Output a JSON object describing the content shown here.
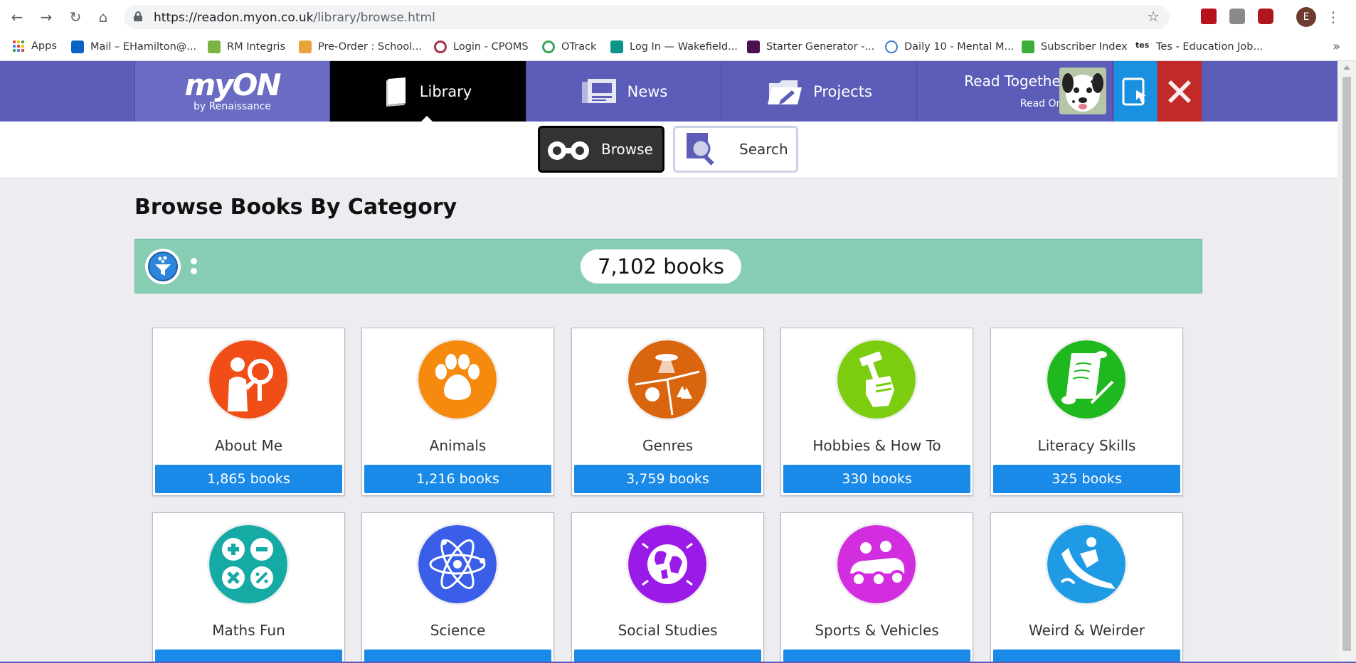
{
  "browser": {
    "url_host": "https://readon.myon.co.uk",
    "url_path": "/library/browse.html",
    "profile_initial": "E",
    "bookmarks": [
      {
        "label": "Apps",
        "color": "#4285f4"
      },
      {
        "label": "Mail – EHamilton@...",
        "color": "#0a64c4"
      },
      {
        "label": "RM Integris",
        "color": "#7cb342"
      },
      {
        "label": "Pre-Order : School...",
        "color": "#e8a23a"
      },
      {
        "label": "Login - CPOMS",
        "color": "#a8344a"
      },
      {
        "label": "OTrack",
        "color": "#3ba55d"
      },
      {
        "label": "Log In — Wakefield...",
        "color": "#0d9488"
      },
      {
        "label": "Starter Generator -...",
        "color": "#4a1050"
      },
      {
        "label": "Daily 10 - Mental M...",
        "color": "#3d7cc9"
      },
      {
        "label": "Subscriber Index",
        "color": "#3cae3a"
      },
      {
        "label": "Tes - Education Job...",
        "color": "#1a1a1a"
      }
    ]
  },
  "header": {
    "logo_main": "myON",
    "logo_sub": "by Renaissance",
    "tabs": [
      {
        "label": "Library",
        "icon": "book-icon"
      },
      {
        "label": "News",
        "icon": "newspaper-icon"
      },
      {
        "label": "Projects",
        "icon": "folder-icon"
      }
    ],
    "read_together": "Read Together",
    "read_on": "Read On!"
  },
  "subnav": {
    "browse_label": "Browse",
    "search_label": "Search"
  },
  "main": {
    "title": "Browse Books By Category",
    "total_books": "7,102 books",
    "categories": [
      {
        "name": "About Me",
        "count": "1,865 books",
        "color": "#f04e16",
        "icon": "magnifier-person-icon"
      },
      {
        "name": "Animals",
        "count": "1,216 books",
        "color": "#f68a0f",
        "icon": "paw-icon"
      },
      {
        "name": "Genres",
        "count": "3,759 books",
        "color": "#d9650e",
        "icon": "genres-icon"
      },
      {
        "name": "Hobbies & How To",
        "count": "330 books",
        "color": "#7ccc10",
        "icon": "hammer-fist-icon"
      },
      {
        "name": "Literacy Skills",
        "count": "325 books",
        "color": "#20b81f",
        "icon": "scroll-icon"
      },
      {
        "name": "Maths Fun",
        "count": "",
        "color": "#16aaa4",
        "icon": "math-symbols-icon"
      },
      {
        "name": "Science",
        "count": "",
        "color": "#3b5ee8",
        "icon": "atom-icon"
      },
      {
        "name": "Social Studies",
        "count": "",
        "color": "#9a1ae8",
        "icon": "globe-icon"
      },
      {
        "name": "Sports & Vehicles",
        "count": "",
        "color": "#d22ee0",
        "icon": "race-car-icon"
      },
      {
        "name": "Weird & Weirder",
        "count": "",
        "color": "#1e9be4",
        "icon": "slide-icon"
      }
    ]
  }
}
